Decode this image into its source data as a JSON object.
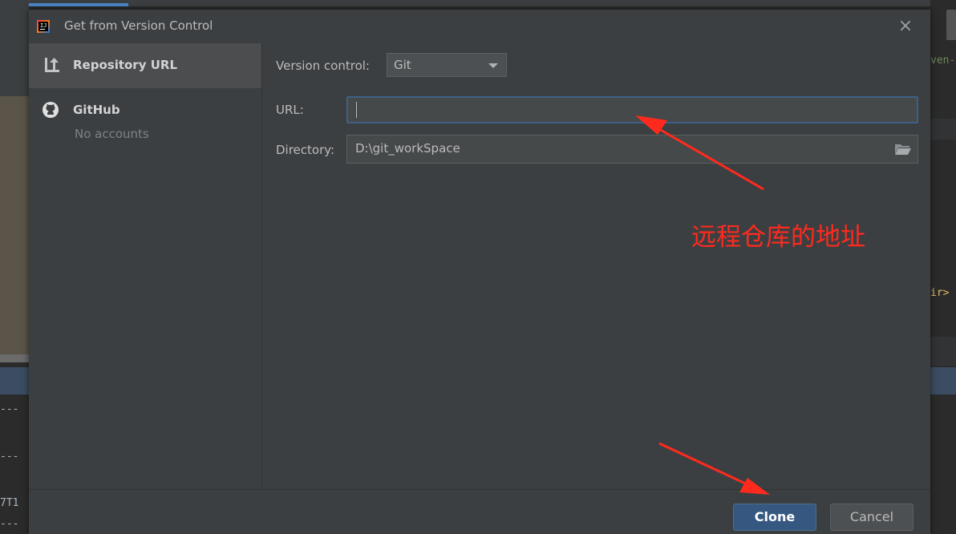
{
  "dialog": {
    "title": "Get from Version Control",
    "close_label": "×"
  },
  "sidebar": {
    "items": [
      {
        "label": "Repository URL",
        "icon": "repository-url-icon",
        "selected": true
      },
      {
        "label": "GitHub",
        "sublabel": "No accounts",
        "icon": "github-icon",
        "selected": false
      }
    ]
  },
  "form": {
    "version_control_label": "Version control:",
    "version_control_value": "Git",
    "url_label": "URL:",
    "url_value": "",
    "directory_label": "Directory:",
    "directory_value": "D:\\git_workSpace"
  },
  "annotation": {
    "text": "远程仓库的地址",
    "color": "#ff2a1e"
  },
  "buttons": {
    "clone": "Clone",
    "cancel": "Cancel"
  },
  "background": {
    "dashes": [
      "---",
      "---",
      "---"
    ],
    "left_text": "7T1",
    "right_text_1": "ven-",
    "right_text_2": "ir>"
  },
  "colors": {
    "accent": "#365880",
    "focus_border": "#3d6185",
    "dialog_bg": "#3c3f41"
  }
}
